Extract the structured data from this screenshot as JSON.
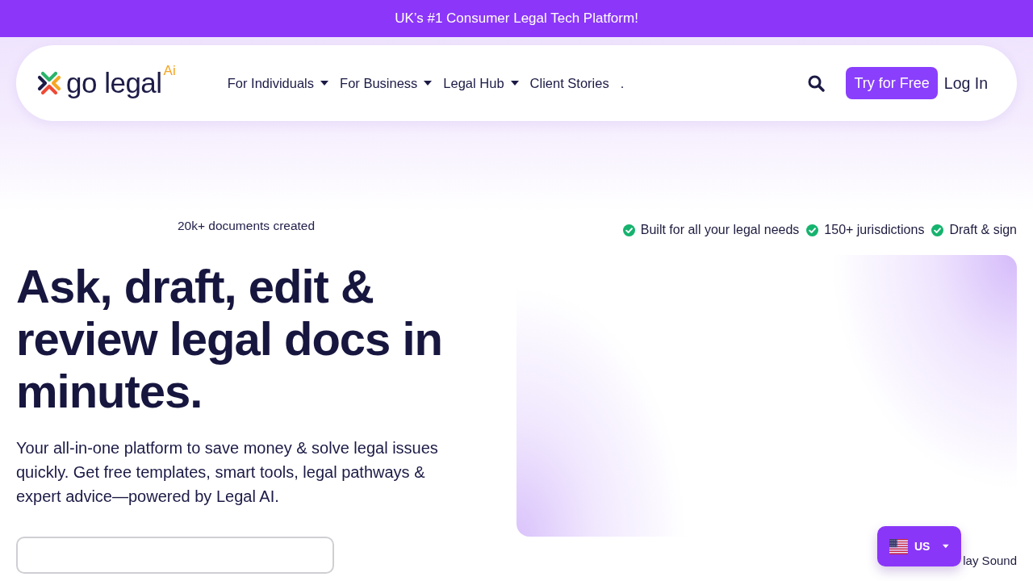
{
  "announcement_bar": {
    "text": "UK’s #1 Consumer Legal Tech Platform!"
  },
  "header": {
    "logo": {
      "wordmark": "go legal",
      "superscript": "Ai"
    },
    "nav_items": [
      {
        "label": "For Individuals",
        "dropdown": true
      },
      {
        "label": "For Business",
        "dropdown": true
      },
      {
        "label": "Legal Hub",
        "dropdown": true
      },
      {
        "label": "Client Stories",
        "dropdown": false
      },
      {
        "label": ".",
        "dropdown": false
      }
    ],
    "try_button": "Try for Free",
    "login_link": "Log In"
  },
  "hero": {
    "stat": "20k+ documents created",
    "features": [
      "Built for all your legal needs",
      "150+ jurisdictions",
      "Draft & sign"
    ],
    "heading": "Ask, draft, edit & review legal docs in minutes.",
    "description": "Your all-in-one platform to save money & solve legal issues quickly. Get free templates, smart tools, legal pathways & expert advice—powered by Legal AI."
  },
  "region_selector": {
    "label": "US"
  },
  "sound_toggle": {
    "label": "lay Sound"
  }
}
